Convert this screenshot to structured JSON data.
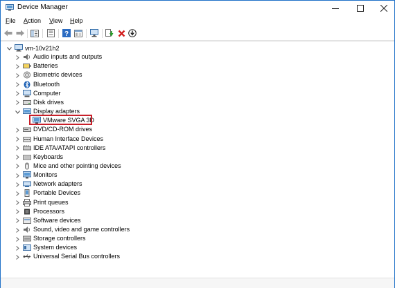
{
  "window": {
    "title": "Device Manager"
  },
  "menu": [
    {
      "accel": "F",
      "rest": "ile"
    },
    {
      "accel": "A",
      "rest": "ction"
    },
    {
      "accel": "V",
      "rest": "iew"
    },
    {
      "accel": "H",
      "rest": "elp"
    }
  ],
  "toolbar_icons": [
    "back-arrow-icon",
    "forward-arrow-icon",
    "show-hide-tree-icon",
    "properties-icon",
    "help-icon",
    "view-icon",
    "scan-hardware-icon",
    "update-driver-icon",
    "uninstall-icon",
    "disable-device-icon"
  ],
  "tree": {
    "root": "vm-10v21h2",
    "items": [
      {
        "label": "Audio inputs and outputs",
        "icon": "speaker-icon",
        "expanded": false
      },
      {
        "label": "Batteries",
        "icon": "battery-icon",
        "expanded": false
      },
      {
        "label": "Biometric devices",
        "icon": "fingerprint-icon",
        "expanded": false
      },
      {
        "label": "Bluetooth",
        "icon": "bluetooth-icon",
        "expanded": false
      },
      {
        "label": "Computer",
        "icon": "computer-icon",
        "expanded": false
      },
      {
        "label": "Disk drives",
        "icon": "disk-drive-icon",
        "expanded": false
      },
      {
        "label": "Display adapters",
        "icon": "display-adapter-icon",
        "expanded": true,
        "children": [
          {
            "label": "VMware SVGA 3D",
            "icon": "monitor-icon",
            "highlighted": true
          }
        ]
      },
      {
        "label": "DVD/CD-ROM drives",
        "icon": "dvd-drive-icon",
        "expanded": false
      },
      {
        "label": "Human Interface Devices",
        "icon": "hid-icon",
        "expanded": false
      },
      {
        "label": "IDE ATA/ATAPI controllers",
        "icon": "ide-controller-icon",
        "expanded": false
      },
      {
        "label": "Keyboards",
        "icon": "keyboard-icon",
        "expanded": false
      },
      {
        "label": "Mice and other pointing devices",
        "icon": "mouse-icon",
        "expanded": false
      },
      {
        "label": "Monitors",
        "icon": "monitor-icon",
        "expanded": false
      },
      {
        "label": "Network adapters",
        "icon": "network-adapter-icon",
        "expanded": false
      },
      {
        "label": "Portable Devices",
        "icon": "portable-device-icon",
        "expanded": false
      },
      {
        "label": "Print queues",
        "icon": "printer-icon",
        "expanded": false
      },
      {
        "label": "Processors",
        "icon": "processor-icon",
        "expanded": false
      },
      {
        "label": "Software devices",
        "icon": "software-device-icon",
        "expanded": false
      },
      {
        "label": "Sound, video and game controllers",
        "icon": "sound-controller-icon",
        "expanded": false
      },
      {
        "label": "Storage controllers",
        "icon": "storage-controller-icon",
        "expanded": false
      },
      {
        "label": "System devices",
        "icon": "system-device-icon",
        "expanded": false
      },
      {
        "label": "Universal Serial Bus controllers",
        "icon": "usb-icon",
        "expanded": false
      }
    ]
  },
  "colors": {
    "highlight_border": "#c8202a",
    "title_accent": "#1e70c8"
  }
}
